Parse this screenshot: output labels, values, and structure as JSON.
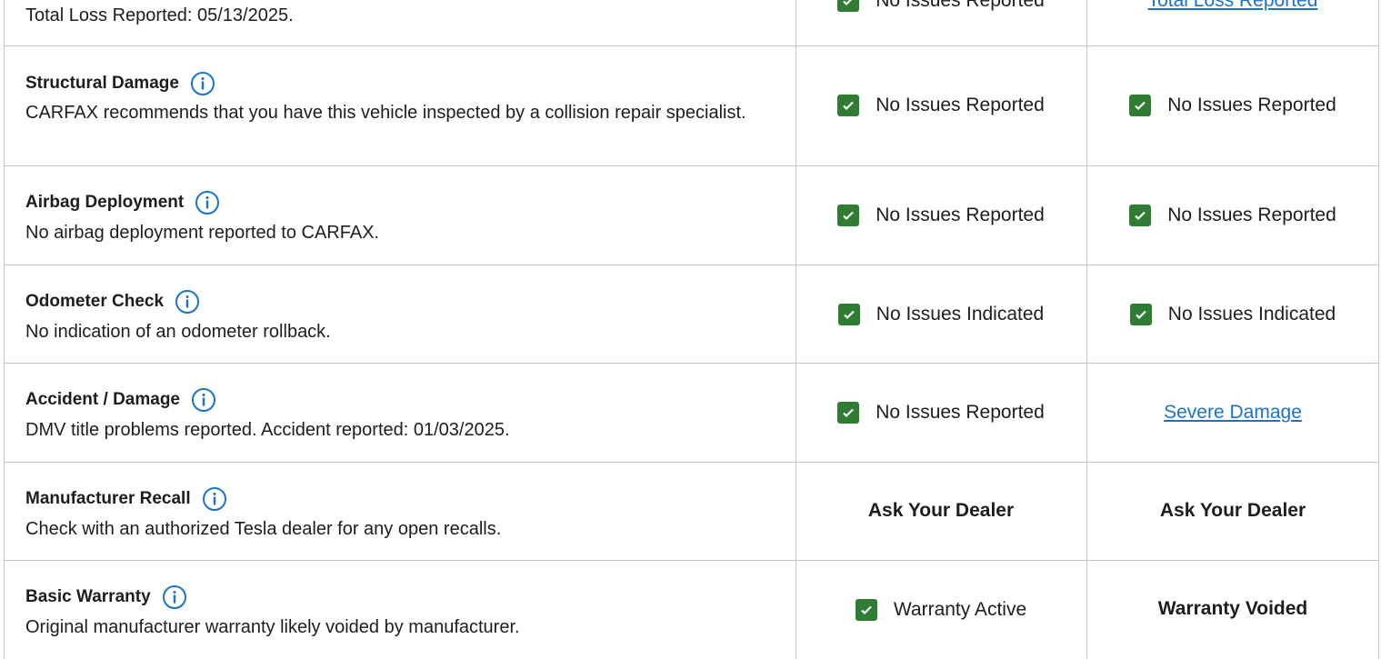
{
  "colors": {
    "check": "#2e7d32",
    "link": "#1a73c8",
    "info": "#1a73c8",
    "border": "#c4c4c4"
  },
  "rows": [
    {
      "desc": "Total Loss Reported: 05/13/2025.",
      "col1": "No Issues Reported",
      "col2": "Total Loss Reported"
    },
    {
      "title": "Structural Damage",
      "desc": "CARFAX recommends that you have this vehicle inspected by a collision repair specialist.",
      "col1": "No Issues Reported",
      "col2": "No Issues Reported"
    },
    {
      "title": "Airbag Deployment",
      "desc": "No airbag deployment reported to CARFAX.",
      "col1": "No Issues Reported",
      "col2": "No Issues Reported"
    },
    {
      "title": "Odometer Check",
      "desc": "No indication of an odometer rollback.",
      "col1": "No Issues Indicated",
      "col2": "No Issues Indicated"
    },
    {
      "title": "Accident / Damage",
      "desc": "DMV title problems reported. Accident reported: 01/03/2025.",
      "col1": "No Issues Reported",
      "col2": "Severe Damage"
    },
    {
      "title": "Manufacturer Recall",
      "desc": "Check with an authorized Tesla dealer for any open recalls.",
      "col1": "Ask Your Dealer",
      "col2": "Ask Your Dealer"
    },
    {
      "title": "Basic Warranty",
      "desc": "Original manufacturer warranty likely voided by manufacturer.",
      "col1": "Warranty Active",
      "col2": "Warranty Voided"
    }
  ]
}
